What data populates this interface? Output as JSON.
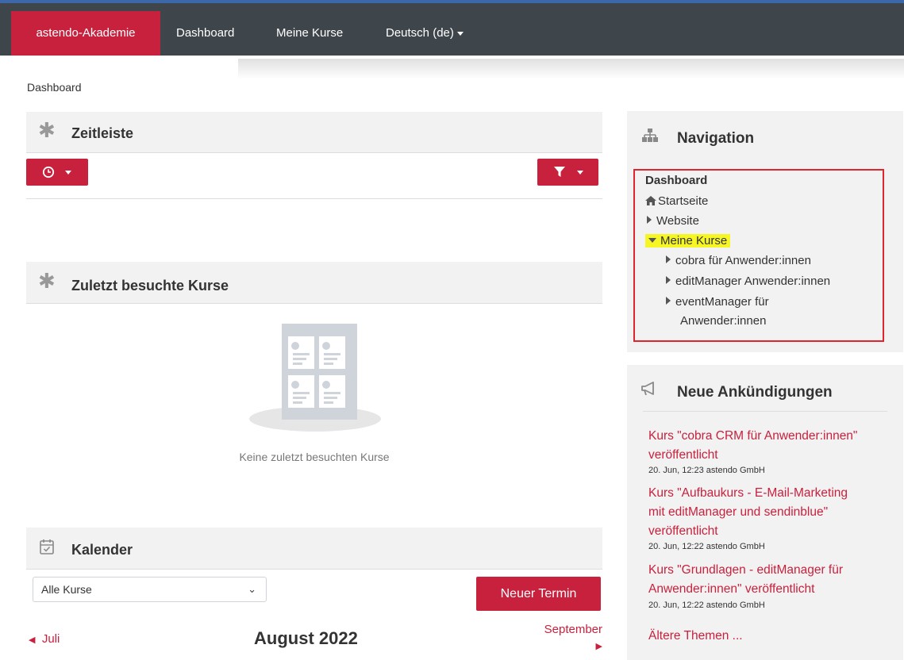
{
  "topnav": {
    "brand": "astendo-Akademie",
    "dashboard": "Dashboard",
    "my_courses": "Meine Kurse",
    "language": "Deutsch (de)"
  },
  "breadcrumb": "Dashboard",
  "timeline": {
    "title": "Zeitleiste"
  },
  "recent": {
    "title": "Zuletzt besuchte Kurse",
    "empty_text": "Keine zuletzt besuchten Kurse"
  },
  "calendar": {
    "title": "Kalender",
    "course_filter": "Alle Kurse",
    "new_event": "Neuer Termin",
    "prev_month": "Juli",
    "current_month": "August 2022",
    "next_month": "September"
  },
  "navigation": {
    "title": "Navigation",
    "items": {
      "dashboard": "Dashboard",
      "home": "Startseite",
      "website": "Website",
      "my_courses": "Meine Kurse",
      "course1": "cobra für Anwender:innen",
      "course2": "editManager Anwender:innen",
      "course3_line1": "eventManager für",
      "course3_line2": "Anwender:innen"
    }
  },
  "announcements": {
    "title": "Neue Ankündigungen",
    "items": [
      {
        "lines": [
          "Kurs \"cobra CRM für Anwender:innen\"",
          "veröffentlicht"
        ],
        "meta": "20. Jun, 12:23  astendo GmbH"
      },
      {
        "lines": [
          "Kurs \"Aufbaukurs - E-Mail-Marketing",
          "mit editManager und sendinblue\"",
          "veröffentlicht"
        ],
        "meta": "20. Jun, 12:22  astendo GmbH"
      },
      {
        "lines": [
          "Kurs \"Grundlagen - editManager für",
          "Anwender:innen\" veröffentlicht"
        ],
        "meta": "20. Jun, 12:22  astendo GmbH"
      }
    ],
    "older": "Ältere Themen ..."
  },
  "colors": {
    "brand_red": "#c8213d",
    "topbar": "#3e464c",
    "highlight": "#f6f627",
    "frame_red": "#e0252e"
  }
}
